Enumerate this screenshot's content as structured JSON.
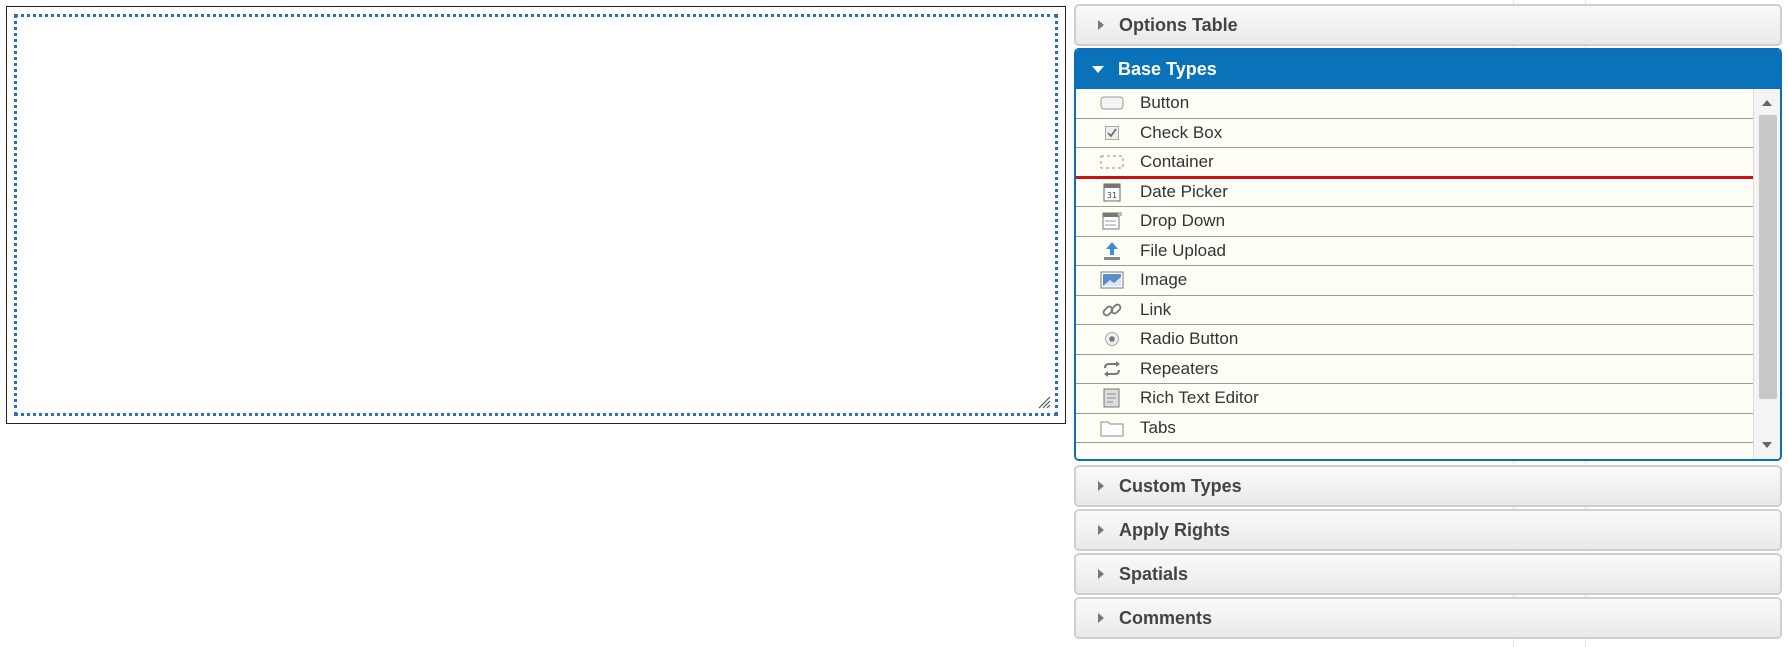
{
  "accordion": {
    "options_table": "Options Table",
    "base_types": {
      "title": "Base Types",
      "items": [
        {
          "label": "Button",
          "icon": "button-icon"
        },
        {
          "label": "Check Box",
          "icon": "checkbox-icon"
        },
        {
          "label": "Container",
          "icon": "container-icon"
        },
        {
          "label": "Date Picker",
          "icon": "calendar-icon"
        },
        {
          "label": "Drop Down",
          "icon": "dropdown-icon"
        },
        {
          "label": "File Upload",
          "icon": "upload-icon"
        },
        {
          "label": "Image",
          "icon": "image-icon"
        },
        {
          "label": "Link",
          "icon": "link-icon"
        },
        {
          "label": "Radio Button",
          "icon": "radio-icon"
        },
        {
          "label": "Repeaters",
          "icon": "repeat-icon"
        },
        {
          "label": "Rich Text Editor",
          "icon": "document-icon"
        },
        {
          "label": "Tabs",
          "icon": "folder-icon"
        }
      ]
    },
    "custom_types": "Custom Types",
    "apply_rights": "Apply Rights",
    "spatials": "Spatials",
    "comments": "Comments"
  },
  "colors": {
    "accent": "#0a72b8",
    "drop_indicator": "#cc1111",
    "drop_zone_border": "#2e6bc6"
  }
}
